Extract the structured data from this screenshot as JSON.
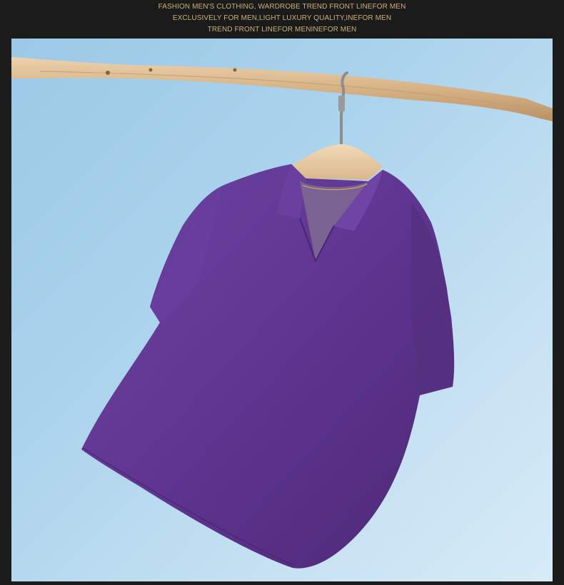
{
  "header": {
    "line1": "FASHION MEN'S CLOTHING, WARDROBE TREND FRONT LINEFOR MEN",
    "line2": "EXCLUSIVELY FOR MEN,LIGHT LUXURY QUALITY,INEFOR MEN",
    "line3": "TREND FRONT LINEFOR MENINEFOR MEN"
  },
  "colors": {
    "background": "#1b1b1b",
    "header_text": "#c9b07a",
    "sky": "#a9d2ec",
    "shirt": "#5e3590",
    "branch": "#d9b78c",
    "hanger": "#e7c9a0"
  },
  "photo": {
    "subject": "purple short-sleeve knit polo shirt on wooden hanger hanging from a branch"
  }
}
